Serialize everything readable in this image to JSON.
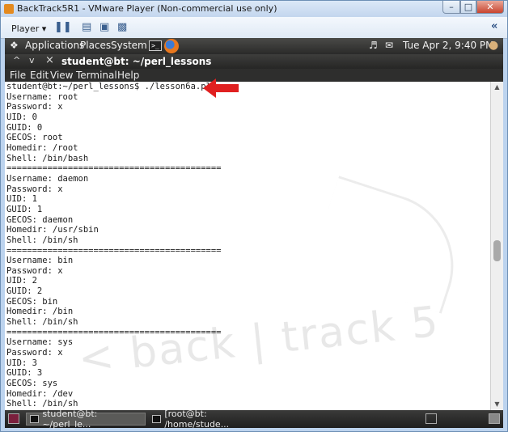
{
  "window": {
    "title": "BackTrack5R1 - VMware Player (Non-commercial use only)",
    "min_glyph": "–",
    "max_glyph": "□",
    "close_glyph": "✕"
  },
  "toolbar": {
    "player_label": "Player ▾",
    "collapse_glyph": "«"
  },
  "panel": {
    "applications": "Applications",
    "places": "Places",
    "system": "System",
    "datetime": "Tue Apr  2,  9:40 PM",
    "terminal_glyph": ">_"
  },
  "terminal_window": {
    "title": "student@bt: ~/perl_lessons",
    "ctrl_up": "^",
    "ctrl_down": "v",
    "ctrl_close": "×"
  },
  "menu": {
    "file": "File",
    "edit": "Edit",
    "view": "View",
    "terminal": "Terminal",
    "help": "Help"
  },
  "terminal": {
    "watermark": "< back | track 5",
    "output": "student@bt:~/perl_lessons$ ./lesson6a.pl\nUsername: root\nPassword: x\nUID: 0\nGUID: 0\nGECOS: root\nHomedir: /root\nShell: /bin/bash\n==========================================\nUsername: daemon\nPassword: x\nUID: 1\nGUID: 1\nGECOS: daemon\nHomedir: /usr/sbin\nShell: /bin/sh\n==========================================\nUsername: bin\nPassword: x\nUID: 2\nGUID: 2\nGECOS: bin\nHomedir: /bin\nShell: /bin/sh\n==========================================\nUsername: sys\nPassword: x\nUID: 3\nGUID: 3\nGECOS: sys\nHomedir: /dev\nShell: /bin/sh"
  },
  "scrollbar": {
    "up_glyph": "▲",
    "down_glyph": "▼"
  },
  "taskbar": {
    "task1": "student@bt: ~/perl_le...",
    "task2": "[root@bt: /home/stude..."
  },
  "colors": {
    "arrow": "#e02020"
  }
}
